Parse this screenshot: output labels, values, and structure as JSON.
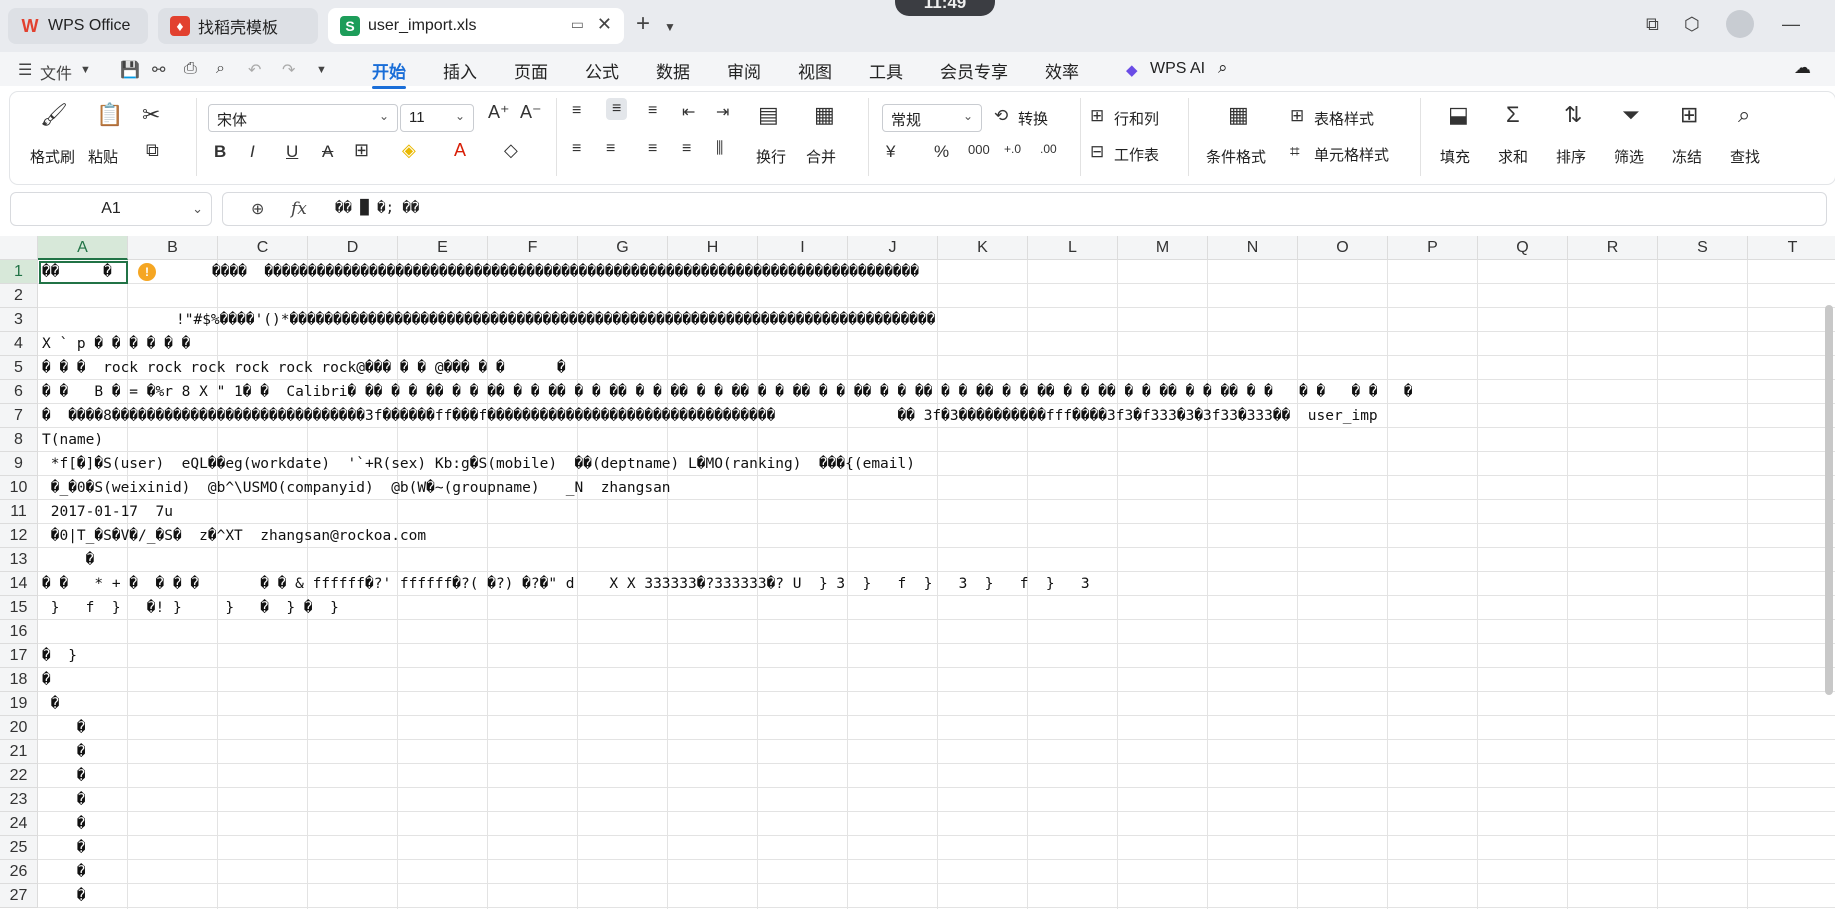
{
  "tabs": [
    {
      "label": "WPS Office",
      "icon": "wps-logo-icon"
    },
    {
      "label": "找稻壳模板",
      "icon": "docer-icon"
    },
    {
      "label": "user_import.xls",
      "icon": "sheet-icon"
    }
  ],
  "clock": "11:49",
  "menu": {
    "file": "文件",
    "items": [
      "开始",
      "插入",
      "页面",
      "公式",
      "数据",
      "审阅",
      "视图",
      "工具",
      "会员专享",
      "效率"
    ],
    "active": "开始",
    "wps_ai": "WPS AI"
  },
  "ribbon": {
    "format_painter": "格式刷",
    "paste": "粘贴",
    "font_name": "宋体",
    "font_size": "11",
    "wrap": "换行",
    "merge": "合并",
    "number_format": "常规",
    "convert": "转换",
    "rows_cols": "行和列",
    "worksheet": "工作表",
    "cond_format": "条件格式",
    "table_style": "表格样式",
    "cell_style": "单元格样式",
    "fill": "填充",
    "sum": "求和",
    "sort": "排序",
    "filter": "筛选",
    "freeze": "冻结",
    "find": "查找"
  },
  "formula": {
    "name_box": "A1",
    "fx": "fx",
    "content": "�� █ �; ��"
  },
  "columns": [
    "A",
    "B",
    "C",
    "D",
    "E",
    "F",
    "G",
    "H",
    "I",
    "J",
    "K",
    "L",
    "M",
    "N",
    "O",
    "P",
    "Q",
    "R",
    "S",
    "T"
  ],
  "rows": [
    "1",
    "2",
    "3",
    "4",
    "5",
    "6",
    "7",
    "8",
    "9",
    "10",
    "11",
    "12",
    "13",
    "14",
    "15",
    "16",
    "17",
    "18",
    "19",
    "20",
    "21",
    "22",
    "23",
    "24",
    "25",
    "26",
    "27"
  ],
  "cells": [
    {
      "row": 1,
      "text": "��     �"
    },
    {
      "row": 1,
      "text": "����  ���������������������������������������������������������������������������"
    },
    {
      "row": 3,
      "text": "!\"#$%����'()*��������������������������������������������������������������������������"
    },
    {
      "row": 4,
      "text": "X ` p � � � � � �"
    },
    {
      "row": 5,
      "text": "� � �  rock rock rock rock rock rock@��� � � @��� � �      �"
    },
    {
      "row": 6,
      "text": "� �   B � = �%r 8 X \" 1� �  Calibri� �� � � �� � � �� � � �� � � �� � � �� � � �� � � �� � � �� � � �� � � �� � � �� � � �� � � �� � � �� � �   � �   � �   �"
    },
    {
      "row": 7,
      "text": "�  ����8�����������������������������3f������ff���f���������������������������������              �� 3f�3����������fff����3f3�f333�3�3f33�333��  user_imp"
    },
    {
      "row": 8,
      "text": "T(name)"
    },
    {
      "row": 9,
      "text": " *f[�]�S(user)  eQL��eg(workdate)  '`+R(sex) Kb:g�S(mobile)  ��(deptname) L�MO(ranking)  ���{(email)"
    },
    {
      "row": 10,
      "text": " �_�0�S(weixinid)  @b^\\USMO(companyid)  @b(W�~(groupname)   _N  zhangsan"
    },
    {
      "row": 11,
      "text": " 2017-01-17  7u"
    },
    {
      "row": 12,
      "text": " �0|T_�S�V�/_�S�  z�^XT  zhangsan@rockoa.com"
    },
    {
      "row": 13,
      "text": "     �"
    },
    {
      "row": 14,
      "text": "� �   * + �  � � �       � � & ffffff�?' ffffff�?( �?) �?�\" d    X X 333333�?333333�? U  } 3  }   f  }   3  }   f  }   3"
    },
    {
      "row": 15,
      "text": " }   f  }   �! }     }   �  } �  }"
    },
    {
      "row": 17,
      "text": "�  }"
    },
    {
      "row": 18,
      "text": "�"
    },
    {
      "row": 19,
      "text": " �"
    },
    {
      "row": 20,
      "text": "    �"
    },
    {
      "row": 21,
      "text": "    �"
    },
    {
      "row": 22,
      "text": "    �"
    },
    {
      "row": 23,
      "text": "    �"
    },
    {
      "row": 24,
      "text": "    �"
    },
    {
      "row": 25,
      "text": "    �"
    },
    {
      "row": 26,
      "text": "    �"
    },
    {
      "row": 27,
      "text": "    �"
    }
  ],
  "colors": {
    "accent": "#1a6ed8",
    "selection": "#217346",
    "wps_red": "#e2412f"
  }
}
